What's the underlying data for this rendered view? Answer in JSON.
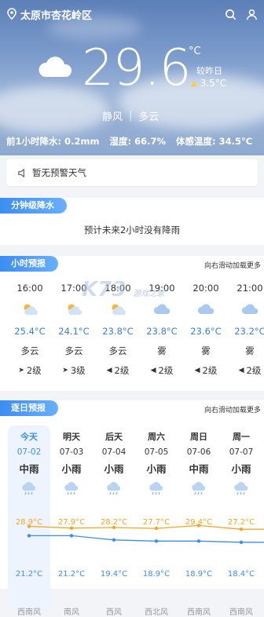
{
  "header": {
    "location": "太原市杏花岭区",
    "temperature": "29.6",
    "degree_unit": "°C",
    "compare_label": "较昨日",
    "compare_value": "3.5°C",
    "wind": "静风",
    "condition": "多云",
    "stats": {
      "rain": "前1小时降水: 0.2mm",
      "humidity": "湿度: 66.7%",
      "feel": "体感温度: 34.5°C"
    }
  },
  "alert": {
    "text": "暂无预警天气"
  },
  "minute_rain": {
    "tag": "分钟级降水",
    "text": "预计未来2小时没有降雨"
  },
  "hourly": {
    "tag": "小时预报",
    "hint": "向右滑动加载更多",
    "items": [
      {
        "time": "16:00",
        "icon": "partly-cloudy-sun",
        "temp": "25.4°C",
        "cond": "多云",
        "wind_icon": "wind-dir-ne",
        "wind": "2级"
      },
      {
        "time": "17:00",
        "icon": "partly-cloudy-sun",
        "temp": "24.1°C",
        "cond": "多云",
        "wind_icon": "wind-dir-ne",
        "wind": "3级"
      },
      {
        "time": "18:00",
        "icon": "partly-cloudy-sun",
        "temp": "23.8°C",
        "cond": "多云",
        "wind_icon": "wind-dir-w",
        "wind": "2级"
      },
      {
        "time": "19:00",
        "icon": "fog-cloud",
        "temp": "23.8°C",
        "cond": "雾",
        "wind_icon": "wind-dir-w",
        "wind": "2级"
      },
      {
        "time": "20:00",
        "icon": "fog-cloud",
        "temp": "23.6°C",
        "cond": "雾",
        "wind_icon": "wind-dir-w",
        "wind": "2级"
      },
      {
        "time": "21:00",
        "icon": "fog-cloud",
        "temp": "23.2°C",
        "cond": "雾",
        "wind_icon": "wind-dir-w",
        "wind": "2级"
      }
    ]
  },
  "daily": {
    "tag": "逐日预报",
    "hint": "向右滑动加载更多",
    "items": [
      {
        "name": "今天",
        "date": "07-02",
        "weather": "中雨",
        "high": "28.9°C",
        "low": "21.2°C",
        "wind": "西南风"
      },
      {
        "name": "明天",
        "date": "07-03",
        "weather": "小雨",
        "high": "27.9°C",
        "low": "21.2°C",
        "wind": "南风"
      },
      {
        "name": "后天",
        "date": "07-04",
        "weather": "小雨",
        "high": "28.2°C",
        "low": "19.4°C",
        "wind": "西风"
      },
      {
        "name": "周六",
        "date": "07-05",
        "weather": "小雨",
        "high": "27.7°C",
        "low": "18.9°C",
        "wind": "西北风"
      },
      {
        "name": "周日",
        "date": "07-06",
        "weather": "中雨",
        "high": "29.4°C",
        "low": "18.9°C",
        "wind": "西南风"
      },
      {
        "name": "周一",
        "date": "07-07",
        "weather": "小雨",
        "high": "27.2°C",
        "low": "18.4°C",
        "wind": "西南风"
      }
    ]
  },
  "watermark": {
    "main": "K73",
    "sub": "游戏之家"
  },
  "colors": {
    "accent": "#3b8df0",
    "high": "#f5a524",
    "low": "#3b8df0"
  }
}
